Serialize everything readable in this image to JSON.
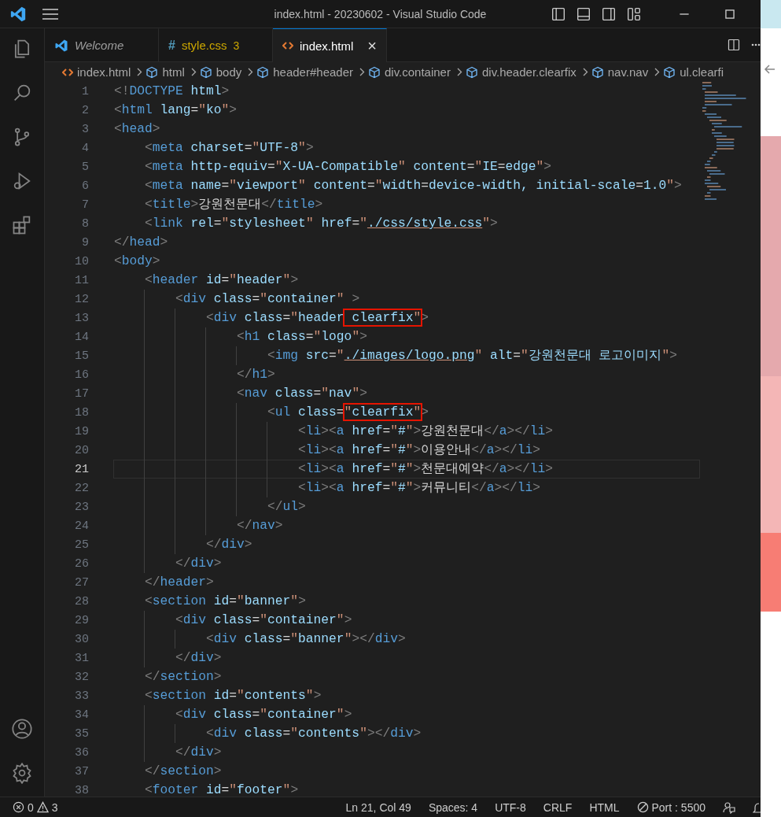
{
  "window": {
    "title": "index.html - 20230602 - Visual Studio Code"
  },
  "tabs": [
    {
      "label": "Welcome",
      "kind": "app",
      "preview": true,
      "warning": false,
      "selected": false
    },
    {
      "label": "style.css",
      "kind": "css",
      "symbol": "#",
      "preview": false,
      "warning": true,
      "count": "3",
      "selected": false
    },
    {
      "label": "index.html",
      "kind": "html",
      "preview": false,
      "warning": false,
      "selected": true,
      "close": "×"
    }
  ],
  "breadcrumb": [
    {
      "label": "index.html",
      "kind": "html"
    },
    {
      "label": "html",
      "kind": "element"
    },
    {
      "label": "body",
      "kind": "element"
    },
    {
      "label": "header#header",
      "kind": "element"
    },
    {
      "label": "div.container",
      "kind": "element"
    },
    {
      "label": "div.header.clearfix",
      "kind": "element"
    },
    {
      "label": "nav.nav",
      "kind": "element"
    },
    {
      "label": "ul.clearfi",
      "kind": "element"
    }
  ],
  "editor": {
    "lines": [
      {
        "number": "1",
        "current": false,
        "segments": [
          {
            "kind": "code",
            "text": "<!DOCTYPE html>"
          }
        ]
      },
      {
        "number": "2",
        "current": false,
        "segments": [
          {
            "kind": "code",
            "text": "<html lang=\"ko\">"
          }
        ]
      },
      {
        "number": "3",
        "current": false,
        "segments": [
          {
            "kind": "code",
            "text": "<head>"
          }
        ]
      },
      {
        "number": "4",
        "current": false,
        "segments": [
          {
            "kind": "code",
            "text": "    <meta charset=\"UTF-8\">"
          }
        ]
      },
      {
        "number": "5",
        "current": false,
        "segments": [
          {
            "kind": "code",
            "text": "    <meta http-equiv=\"X-UA-Compatible\" content=\"IE=edge\">"
          }
        ]
      },
      {
        "number": "6",
        "current": false,
        "segments": [
          {
            "kind": "code",
            "text": "    <meta name=\"viewport\" content=\"width=device-width, initial-scale=1.0\">"
          }
        ]
      },
      {
        "number": "7",
        "current": false,
        "segments": [
          {
            "kind": "code",
            "text": "    <title>강원천문대</title>"
          }
        ]
      },
      {
        "number": "8",
        "current": false,
        "segments": [
          {
            "kind": "code",
            "text": "    <link rel=\"stylesheet\" href=\""
          },
          {
            "kind": "link",
            "text": "./css/style.css"
          },
          {
            "kind": "code",
            "text": "\">"
          }
        ]
      },
      {
        "number": "9",
        "current": false,
        "segments": [
          {
            "kind": "code",
            "text": "</head>"
          }
        ]
      },
      {
        "number": "10",
        "current": false,
        "segments": [
          {
            "kind": "code",
            "text": "<body>"
          }
        ]
      },
      {
        "number": "11",
        "current": false,
        "segments": [
          {
            "kind": "code",
            "text": "    <header id=\"header\">"
          }
        ]
      },
      {
        "number": "12",
        "current": false,
        "segments": [
          {
            "kind": "code",
            "text": "        <div class=\"container\" >"
          }
        ]
      },
      {
        "number": "13",
        "current": false,
        "segments": [
          {
            "kind": "code",
            "text": "            <div class=\"header"
          },
          {
            "kind": "boxed",
            "text": " clearfix\""
          },
          {
            "kind": "code",
            "text": ">"
          }
        ]
      },
      {
        "number": "14",
        "current": false,
        "segments": [
          {
            "kind": "code",
            "text": "                <h1 class=\"logo\">"
          }
        ]
      },
      {
        "number": "15",
        "current": false,
        "segments": [
          {
            "kind": "code",
            "text": "                    <img src=\""
          },
          {
            "kind": "link",
            "text": "./images/logo.png"
          },
          {
            "kind": "code",
            "text": "\" alt=\"강원천문대 로고이미지\">"
          }
        ]
      },
      {
        "number": "16",
        "current": false,
        "segments": [
          {
            "kind": "code",
            "text": "                </h1>"
          }
        ]
      },
      {
        "number": "17",
        "current": false,
        "segments": [
          {
            "kind": "code",
            "text": "                <nav class=\"nav\">"
          }
        ]
      },
      {
        "number": "18",
        "current": false,
        "segments": [
          {
            "kind": "code",
            "text": "                    <ul class="
          },
          {
            "kind": "boxed",
            "text": "\"clearfix\""
          },
          {
            "kind": "code",
            "text": ">"
          }
        ]
      },
      {
        "number": "19",
        "current": false,
        "segments": [
          {
            "kind": "code",
            "text": "                        <li><a href=\"#\">강원천문대</a></li>"
          }
        ]
      },
      {
        "number": "20",
        "current": false,
        "segments": [
          {
            "kind": "code",
            "text": "                        <li><a href=\"#\">이용안내</a></li>"
          }
        ]
      },
      {
        "number": "21",
        "current": true,
        "segments": [
          {
            "kind": "code",
            "text": "                        <li><a href=\"#\">천문대예약</a></li>"
          }
        ]
      },
      {
        "number": "22",
        "current": false,
        "segments": [
          {
            "kind": "code",
            "text": "                        <li><a href=\"#\">커뮤니티</a></li>"
          }
        ]
      },
      {
        "number": "23",
        "current": false,
        "segments": [
          {
            "kind": "code",
            "text": "                    </ul>"
          }
        ]
      },
      {
        "number": "24",
        "current": false,
        "segments": [
          {
            "kind": "code",
            "text": "                </nav>"
          }
        ]
      },
      {
        "number": "25",
        "current": false,
        "segments": [
          {
            "kind": "code",
            "text": "            </div>"
          }
        ]
      },
      {
        "number": "26",
        "current": false,
        "segments": [
          {
            "kind": "code",
            "text": "        </div>"
          }
        ]
      },
      {
        "number": "27",
        "current": false,
        "segments": [
          {
            "kind": "code",
            "text": "    </header>"
          }
        ]
      },
      {
        "number": "28",
        "current": false,
        "segments": [
          {
            "kind": "code",
            "text": "    <section id=\"banner\">"
          }
        ]
      },
      {
        "number": "29",
        "current": false,
        "segments": [
          {
            "kind": "code",
            "text": "        <div class=\"container\">"
          }
        ]
      },
      {
        "number": "30",
        "current": false,
        "segments": [
          {
            "kind": "code",
            "text": "            <div class=\"banner\"></div>"
          }
        ]
      },
      {
        "number": "31",
        "current": false,
        "segments": [
          {
            "kind": "code",
            "text": "        </div>"
          }
        ]
      },
      {
        "number": "32",
        "current": false,
        "segments": [
          {
            "kind": "code",
            "text": "    </section>"
          }
        ]
      },
      {
        "number": "33",
        "current": false,
        "segments": [
          {
            "kind": "code",
            "text": "    <section id=\"contents\">"
          }
        ]
      },
      {
        "number": "34",
        "current": false,
        "segments": [
          {
            "kind": "code",
            "text": "        <div class=\"container\">"
          }
        ]
      },
      {
        "number": "35",
        "current": false,
        "segments": [
          {
            "kind": "code",
            "text": "            <div class=\"contents\"></div>"
          }
        ]
      },
      {
        "number": "36",
        "current": false,
        "segments": [
          {
            "kind": "code",
            "text": "        </div>"
          }
        ]
      },
      {
        "number": "37",
        "current": false,
        "segments": [
          {
            "kind": "code",
            "text": "    </section>"
          }
        ]
      },
      {
        "number": "38",
        "current": false,
        "segments": [
          {
            "kind": "code",
            "text": "    <footer id=\"footer\">"
          }
        ]
      }
    ]
  },
  "status_bar": {
    "errors": "0",
    "warnings": "3",
    "items": [
      "Ln 21, Col 49",
      "Spaces: 4",
      "UTF-8",
      "CRLF",
      "HTML"
    ],
    "port": "Port : 5500"
  }
}
